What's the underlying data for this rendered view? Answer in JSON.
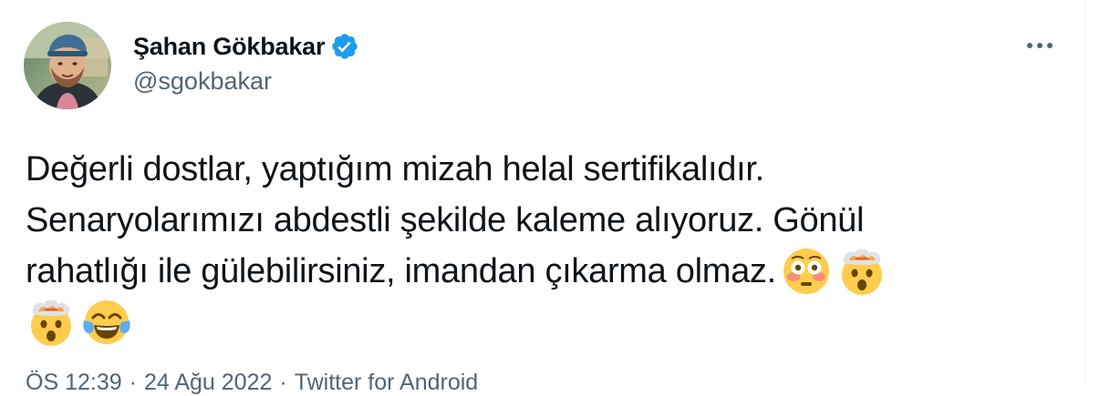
{
  "author": {
    "display_name": "Şahan Gökbakar",
    "handle": "@sgokbakar",
    "verified": true,
    "verified_color": "#1d9bf0"
  },
  "tweet": {
    "lines": [
      {
        "text": "Değerli dostlar, yaptığım mizah helal sertifikalıdır.",
        "emojis": []
      },
      {
        "text": "Senaryolarımızı abdestli şekilde kaleme alıyoruz. Gönül",
        "emojis": []
      },
      {
        "text": "rahatlığı ile gülebilirsiniz, imandan çıkarma olmaz.",
        "emojis": [
          "flushed-face",
          "exploding-head"
        ]
      },
      {
        "text": "",
        "emojis": [
          "exploding-head",
          "face-with-tears-of-joy"
        ]
      }
    ]
  },
  "meta": {
    "time": "ÖS 12:39",
    "date": "24 Ağu 2022",
    "separator": "·",
    "source": "Twitter for Android"
  },
  "icons": {
    "more": "more-horizontal-icon",
    "verified": "verified-badge-icon"
  }
}
